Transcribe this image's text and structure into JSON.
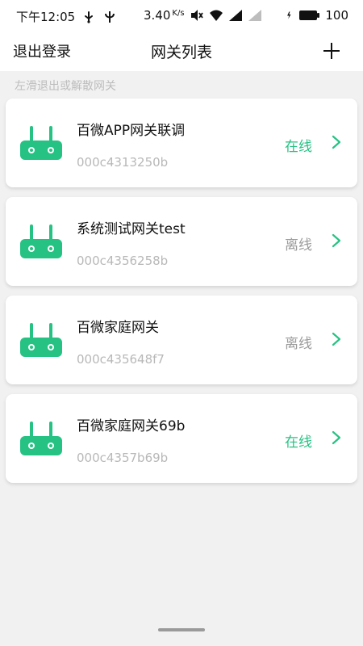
{
  "status_bar": {
    "time": "下午12:05",
    "speed": "3.40",
    "speed_unit": "K/s",
    "battery": "100"
  },
  "header": {
    "logout": "退出登录",
    "title": "网关列表",
    "add_icon": "plus-icon"
  },
  "hint": "左滑退出或解散网关",
  "colors": {
    "accent": "#26c283",
    "online": "#26c283",
    "offline": "#9b9b9b"
  },
  "gateways": [
    {
      "name": "百微APP网关联调",
      "mac": "000c4313250b",
      "status": "在线",
      "online": true,
      "icon": "router-icon"
    },
    {
      "name": "系统测试网关test",
      "mac": "000c4356258b",
      "status": "离线",
      "online": false,
      "icon": "router-icon"
    },
    {
      "name": "百微家庭网关",
      "mac": "000c435648f7",
      "status": "离线",
      "online": false,
      "icon": "router-icon"
    },
    {
      "name": "百微家庭网关69b",
      "mac": "000c4357b69b",
      "status": "在线",
      "online": true,
      "icon": "router-icon"
    }
  ]
}
